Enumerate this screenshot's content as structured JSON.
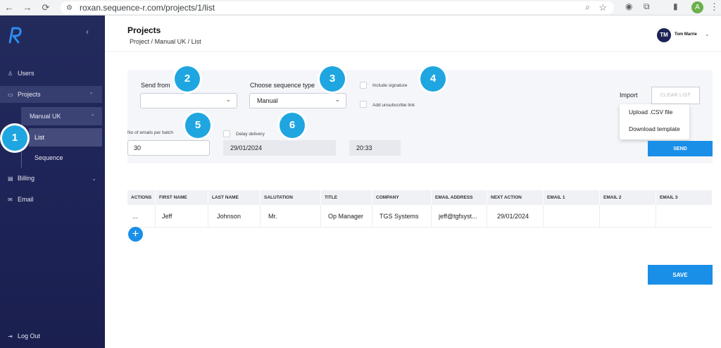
{
  "browser": {
    "url": "roxan.sequence-r.com/projects/1/list",
    "profile_initial": "A"
  },
  "sidebar": {
    "logo": "R",
    "items": [
      {
        "label": "Users",
        "icon": "user-icon"
      },
      {
        "label": "Projects",
        "icon": "folder-icon"
      },
      {
        "label": "Manual UK"
      },
      {
        "label": "List"
      },
      {
        "label": "Sequence"
      },
      {
        "label": "Billing",
        "icon": "billing-icon"
      },
      {
        "label": "Email",
        "icon": "mail-icon"
      }
    ],
    "logout": "Log Out"
  },
  "header": {
    "title": "Projects",
    "breadcrumb": {
      "root": "Project",
      "sep": "/",
      "project": "Manual UK",
      "page": "List"
    },
    "user": {
      "initials": "TM",
      "name": "Tom Marrie"
    }
  },
  "form": {
    "send_from_label": "Send from",
    "send_from_value": "",
    "sequence_type_label": "Choose sequence type",
    "sequence_type_value": "Manual",
    "include_signature": "Include signature",
    "unsubscribe_link": "Add unsubscribe link",
    "emails_per_batch_label": "No of emails per batch",
    "emails_per_batch_value": "30",
    "delay_delivery": "Delay delivery",
    "delay_date": "29/01/2024",
    "delay_time": "20:33",
    "import_label": "Import",
    "clear_list": "CLEAR LIST",
    "import_options": [
      "Upload .CSV file",
      "Download template"
    ],
    "send": "SEND"
  },
  "badges": [
    "1",
    "2",
    "3",
    "4",
    "5",
    "6"
  ],
  "table": {
    "columns": [
      "ACTIONS",
      "FIRST NAME",
      "LAST NAME",
      "SALUTATION",
      "TITLE",
      "COMPANY",
      "EMAIL ADDRESS",
      "NEXT ACTION",
      "EMAIL 1",
      "EMAIL 2",
      "EMAIL 3"
    ],
    "rows": [
      [
        "...",
        "Jeff",
        "Johnson",
        "Mr.",
        "Op Manager",
        "TGS Systems",
        "jeff@tgfsyst...",
        "29/01/2024",
        "",
        "",
        ""
      ]
    ]
  },
  "save": "SAVE",
  "colors": {
    "accent": "#1a8fe8",
    "badge": "#1fa6e0",
    "sidebar": "#1d2356"
  }
}
